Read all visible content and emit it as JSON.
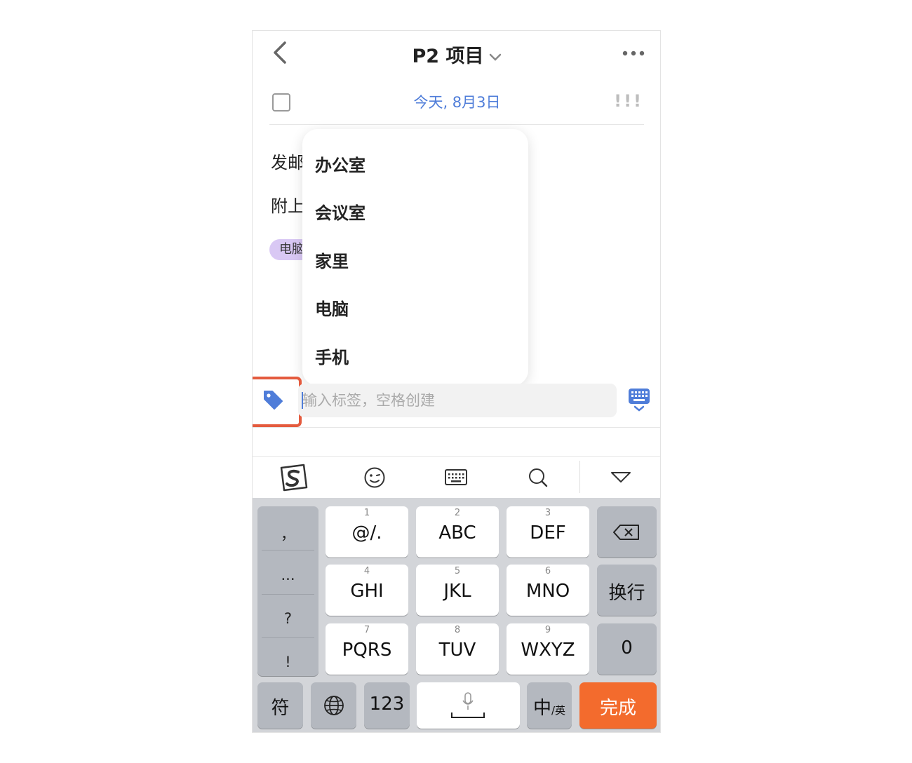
{
  "header": {
    "title": "P2 项目"
  },
  "task": {
    "date": "今天, 8月3日",
    "priority": "!!!",
    "body_lines": [
      "发邮",
      "附上"
    ],
    "tag_chip": "电脑"
  },
  "tag_dropdown": {
    "items": [
      "办公室",
      "会议室",
      "家里",
      "电脑",
      "手机"
    ]
  },
  "tag_input": {
    "placeholder": "输入标签，空格创建",
    "value": ""
  },
  "keyboard": {
    "symbols": [
      "，",
      "...",
      "?",
      "!"
    ],
    "keys": [
      {
        "num": "1",
        "label": "@/."
      },
      {
        "num": "2",
        "label": "ABC"
      },
      {
        "num": "3",
        "label": "DEF"
      },
      {
        "num": "4",
        "label": "GHI"
      },
      {
        "num": "5",
        "label": "JKL"
      },
      {
        "num": "6",
        "label": "MNO"
      },
      {
        "num": "7",
        "label": "PQRS"
      },
      {
        "num": "8",
        "label": "TUV"
      },
      {
        "num": "9",
        "label": "WXYZ"
      }
    ],
    "newline": "换行",
    "zero": "0",
    "fu": "符",
    "num_mode": "123",
    "lang_main": "中",
    "lang_sub": "/英",
    "done": "完成"
  },
  "colors": {
    "accent": "#4f7dd9",
    "highlight_border": "#e45b3e",
    "done_key": "#f36b2d",
    "chip": "#d9c8f4"
  }
}
